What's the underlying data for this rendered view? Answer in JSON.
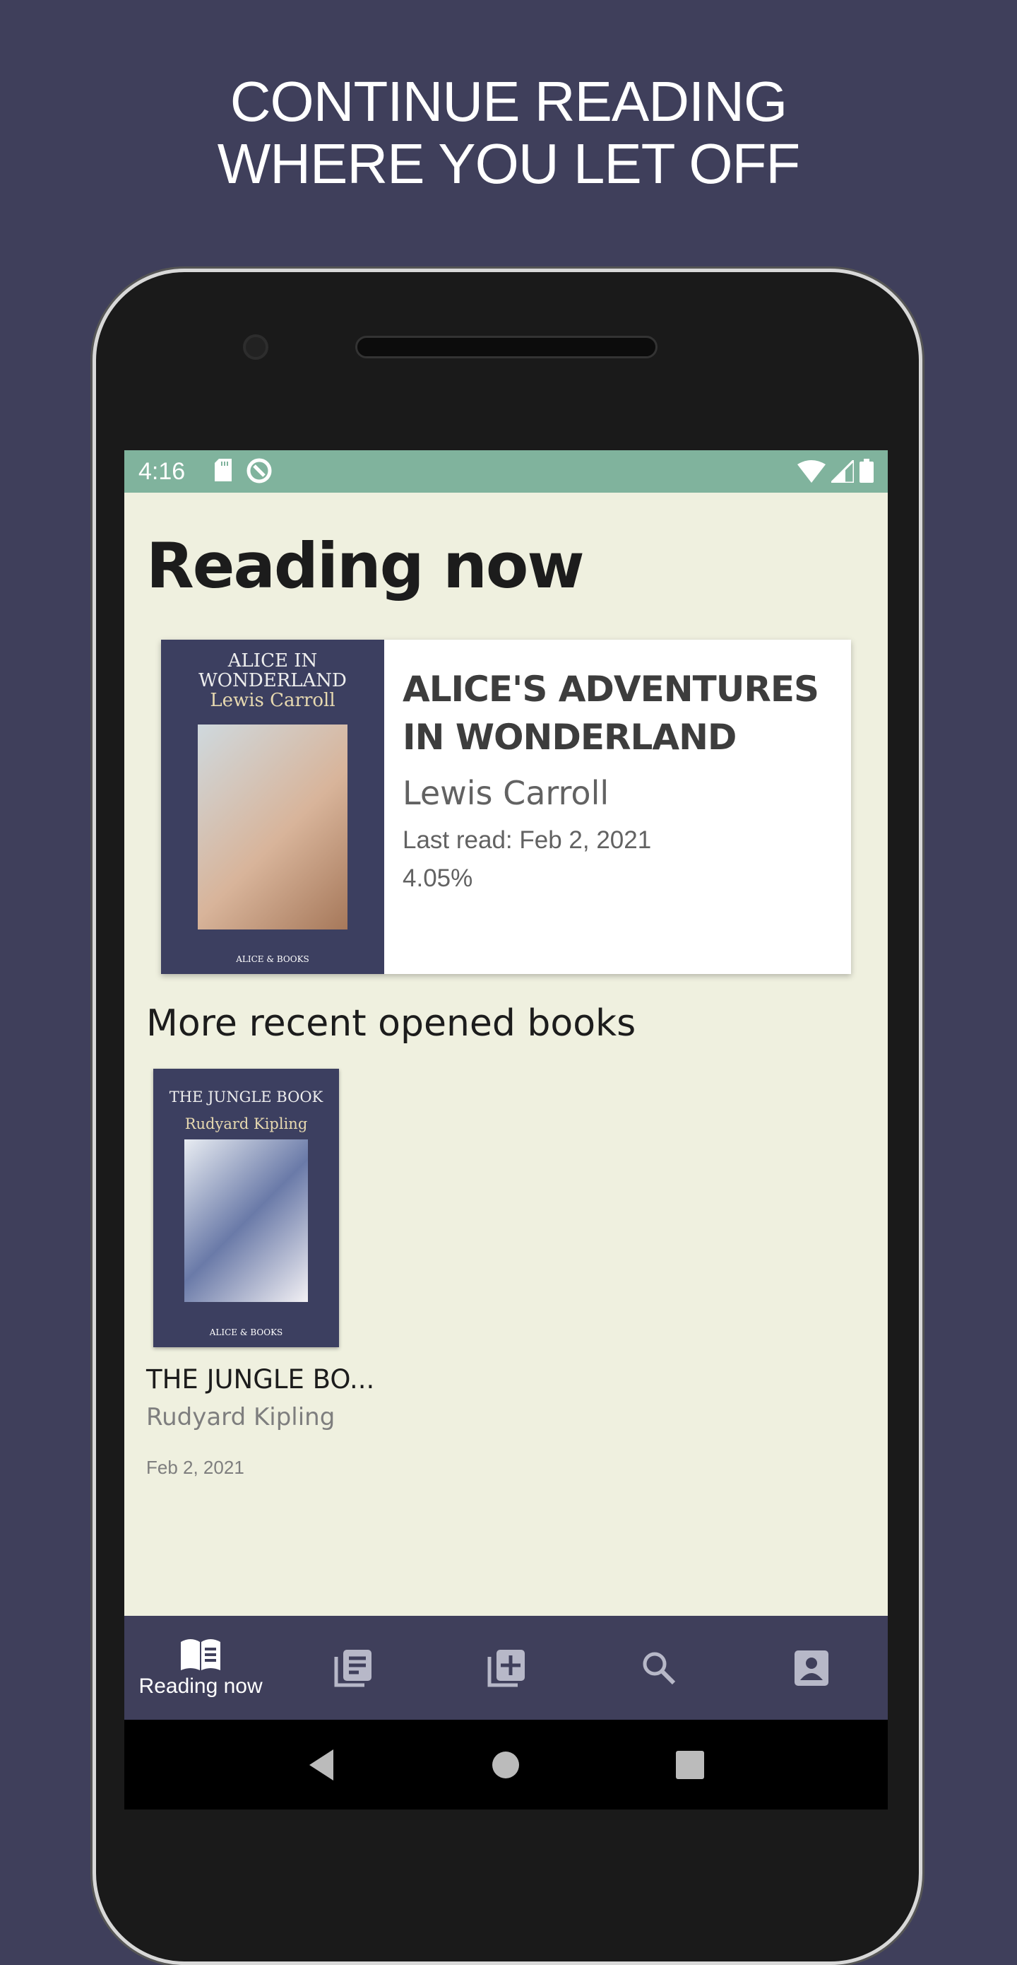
{
  "headline": {
    "line1": "CONTINUE READING",
    "line2": "WHERE YOU LET OFF"
  },
  "status_bar": {
    "time": "4:16",
    "icons_left": [
      "sd-card-icon",
      "sync-icon"
    ],
    "icons_right": [
      "wifi-icon",
      "signal-icon",
      "battery-icon"
    ]
  },
  "page_title": "Reading now",
  "current_book": {
    "cover": {
      "title_line1": "ALICE IN",
      "title_line2": "WONDERLAND",
      "author": "Lewis Carroll",
      "publisher": "ALICE & BOOKS"
    },
    "title": "ALICE'S ADVENTURES IN WONDERLAND",
    "author": "Lewis Carroll",
    "last_read": "Last read: Feb 2, 2021",
    "progress": "4.05%"
  },
  "recent_heading": "More recent opened books",
  "recent_books": [
    {
      "cover": {
        "title": "THE JUNGLE BOOK",
        "author": "Rudyard Kipling",
        "publisher": "ALICE & BOOKS"
      },
      "title": "THE JUNGLE BO...",
      "author": "Rudyard Kipling",
      "date": "Feb 2, 2021"
    }
  ],
  "bottom_nav": [
    {
      "icon": "open-book-icon",
      "label": "Reading now",
      "active": true
    },
    {
      "icon": "library-icon",
      "label": "",
      "active": false
    },
    {
      "icon": "add-library-icon",
      "label": "",
      "active": false
    },
    {
      "icon": "search-icon",
      "label": "",
      "active": false
    },
    {
      "icon": "account-icon",
      "label": "",
      "active": false
    }
  ],
  "colors": {
    "background": "#3f3f5b",
    "status_bar": "#80b39d",
    "content": "#eff0df",
    "nav": "#3f3f5b"
  }
}
